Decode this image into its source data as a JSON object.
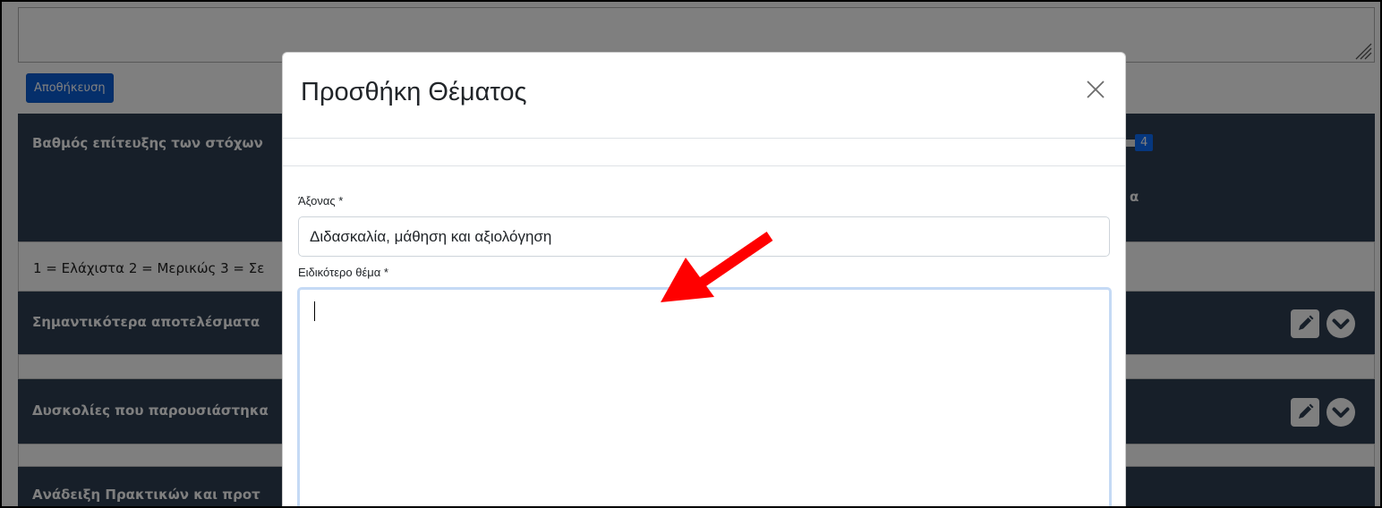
{
  "background": {
    "save_button": "Αποθήκευση",
    "panels": [
      "Βαθμός επίτευξης των στόχων",
      "Σημαντικότερα αποτελέσματα",
      "Δυσκολίες που παρουσιάστηκα",
      "Ανάδειξη Πρακτικών και προτ"
    ],
    "scale_text": "1 = Ελάχιστα 2 = Μερικώς 3 = Σε",
    "badge_value": "4",
    "right_fragment": "α"
  },
  "modal": {
    "title": "Προσθήκη Θέματος",
    "axis_label": "Άξονας *",
    "axis_value": "Διδασκαλία, μάθηση και αξιολόγηση",
    "topic_label": "Ειδικότερο θέμα *",
    "topic_value": ""
  },
  "icons": {
    "close": "close-icon",
    "edit": "pencil-icon",
    "expand": "chevron-down-icon",
    "annotation": "red-arrow"
  },
  "colors": {
    "panel": "#2f3e52",
    "primary": "#0b5ed7",
    "arrow": "#ff0000",
    "focus": "#c5daf5"
  }
}
